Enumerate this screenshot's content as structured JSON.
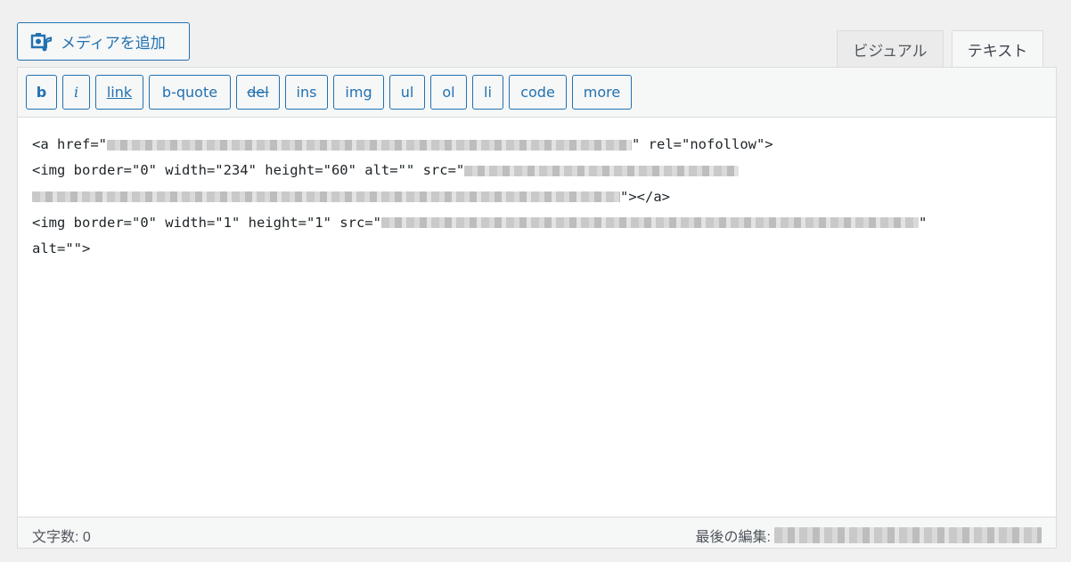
{
  "media_button": {
    "label": "メディアを追加",
    "icon": "media-add-icon"
  },
  "mode_tabs": {
    "visual": "ビジュアル",
    "text": "テキスト",
    "active": "text"
  },
  "quicktags": [
    "b",
    "i",
    "link",
    "b-quote",
    "del",
    "ins",
    "img",
    "ul",
    "ol",
    "li",
    "code",
    "more"
  ],
  "content": {
    "line1_pre": "<a href=\"",
    "line1_post": "\" rel=\"nofollow\">",
    "line2_pre": "<img border=\"0\" width=\"234\" height=\"60\" alt=\"\" src=\"",
    "line3_post": "\"></a>",
    "line4_pre": "<img border=\"0\" width=\"1\" height=\"1\" src=\"",
    "line4_post": "\"",
    "line5": "alt=\"\">"
  },
  "status": {
    "word_count": "文字数: 0",
    "last_edit_label": "最後の編集:"
  },
  "colors": {
    "accent": "#2271b1",
    "background": "#f0f0f1",
    "toolbar": "#f6f7f7"
  }
}
